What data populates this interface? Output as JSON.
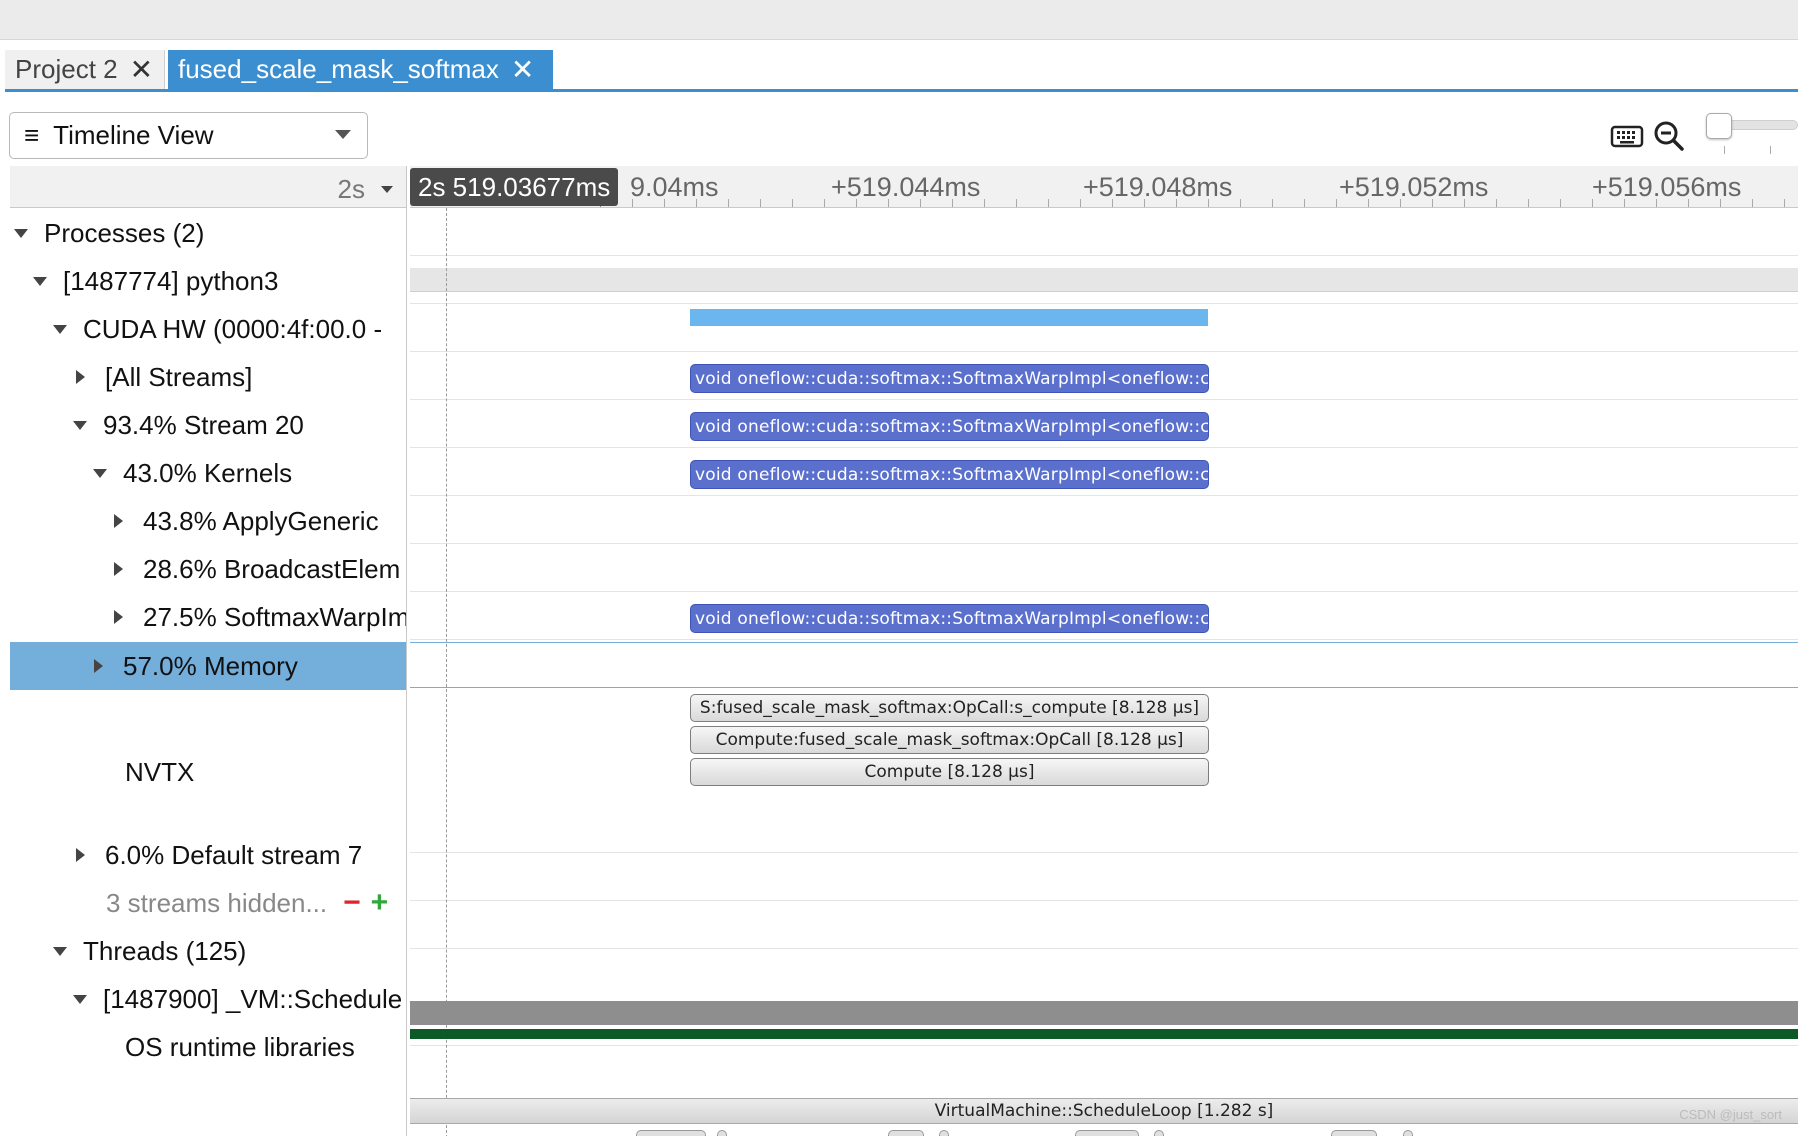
{
  "tabs": [
    {
      "label": "Project 2",
      "active": false
    },
    {
      "label": "fused_scale_mask_softmax",
      "active": true
    }
  ],
  "toolbar": {
    "view_select_value": "Timeline View",
    "icons": [
      "keyboard-icon",
      "zoom-out-icon",
      "zoom-slider"
    ]
  },
  "scale": {
    "label": "2s"
  },
  "ruler": {
    "badge": "2s 519.03677ms",
    "partial_label": "9.04ms",
    "labels": [
      "+519.044ms",
      "+519.048ms",
      "+519.052ms",
      "+519.056ms"
    ]
  },
  "tree": {
    "processes": "Processes (2)",
    "process": "[1487774] python3",
    "cuda_hw": "CUDA HW (0000:4f:00.0 -",
    "all_streams": "[All Streams]",
    "stream20": "93.4% Stream 20",
    "kernels": "43.0% Kernels",
    "apply_generic": "43.8% ApplyGeneric",
    "broadcast": "28.6% BroadcastElem",
    "softmax": "27.5% SoftmaxWarpIm",
    "memory": "57.0% Memory",
    "nvtx": "NVTX",
    "default_stream": "6.0% Default stream 7",
    "streams_hidden": "3 streams hidden...",
    "minus": "−",
    "plus": "+",
    "threads": "Threads (125)",
    "thread": "[1487900] _VM::Schedule",
    "os_runtime": "OS runtime libraries"
  },
  "kernels": {
    "label": "void oneflow::cuda::softmax::SoftmaxWarpImpl<oneflow::cu..."
  },
  "nvtx_ranges": [
    "S:fused_scale_mask_softmax:OpCall:s_compute [8.128 µs]",
    "Compute:fused_scale_mask_softmax:OpCall [8.128 µs]",
    "Compute [8.128 µs]"
  ],
  "os_runtime_bar": "VirtualMachine::ScheduleLoop [1.282 s]",
  "watermark": "CSDN @just_sort",
  "colors": {
    "accent": "#3b8fd0",
    "selection": "#74aedb",
    "kernel": "#5b70cd",
    "hw_bar": "#6bb6ee",
    "thread_green": "#0d5a29"
  }
}
